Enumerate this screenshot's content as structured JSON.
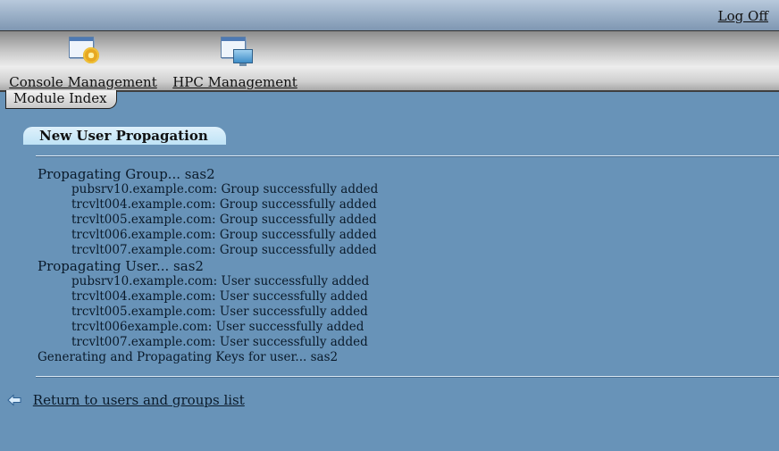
{
  "header": {
    "logoff_label": "Log Off"
  },
  "toolbar": {
    "items": [
      {
        "label": "Console Management",
        "icon": "console-settings-icon"
      },
      {
        "label": "HPC Management",
        "icon": "hpc-monitor-icon"
      }
    ]
  },
  "module_tab": {
    "label": "Module Index"
  },
  "section": {
    "title": "New User Propagation"
  },
  "log": {
    "group_header": "Propagating Group... sas2",
    "group_lines": [
      "pubsrv10.example.com: Group successfully added",
      "trcvlt004.example.com: Group successfully added",
      "trcvlt005.example.com: Group successfully added",
      "trcvlt006.example.com: Group successfully added",
      "trcvlt007.example.com: Group successfully added"
    ],
    "user_header": "Propagating User... sas2",
    "user_lines": [
      "pubsrv10.example.com: User successfully added",
      "trcvlt004.example.com: User successfully added",
      "trcvlt005.example.com: User successfully added",
      "trcvlt006example.com: User successfully added",
      "trcvlt007.example.com: User successfully added"
    ],
    "keys_line": "Generating and Propagating Keys for user... sas2"
  },
  "return_link": {
    "label": "Return to users and groups list",
    "icon": "back-arrow-icon"
  }
}
